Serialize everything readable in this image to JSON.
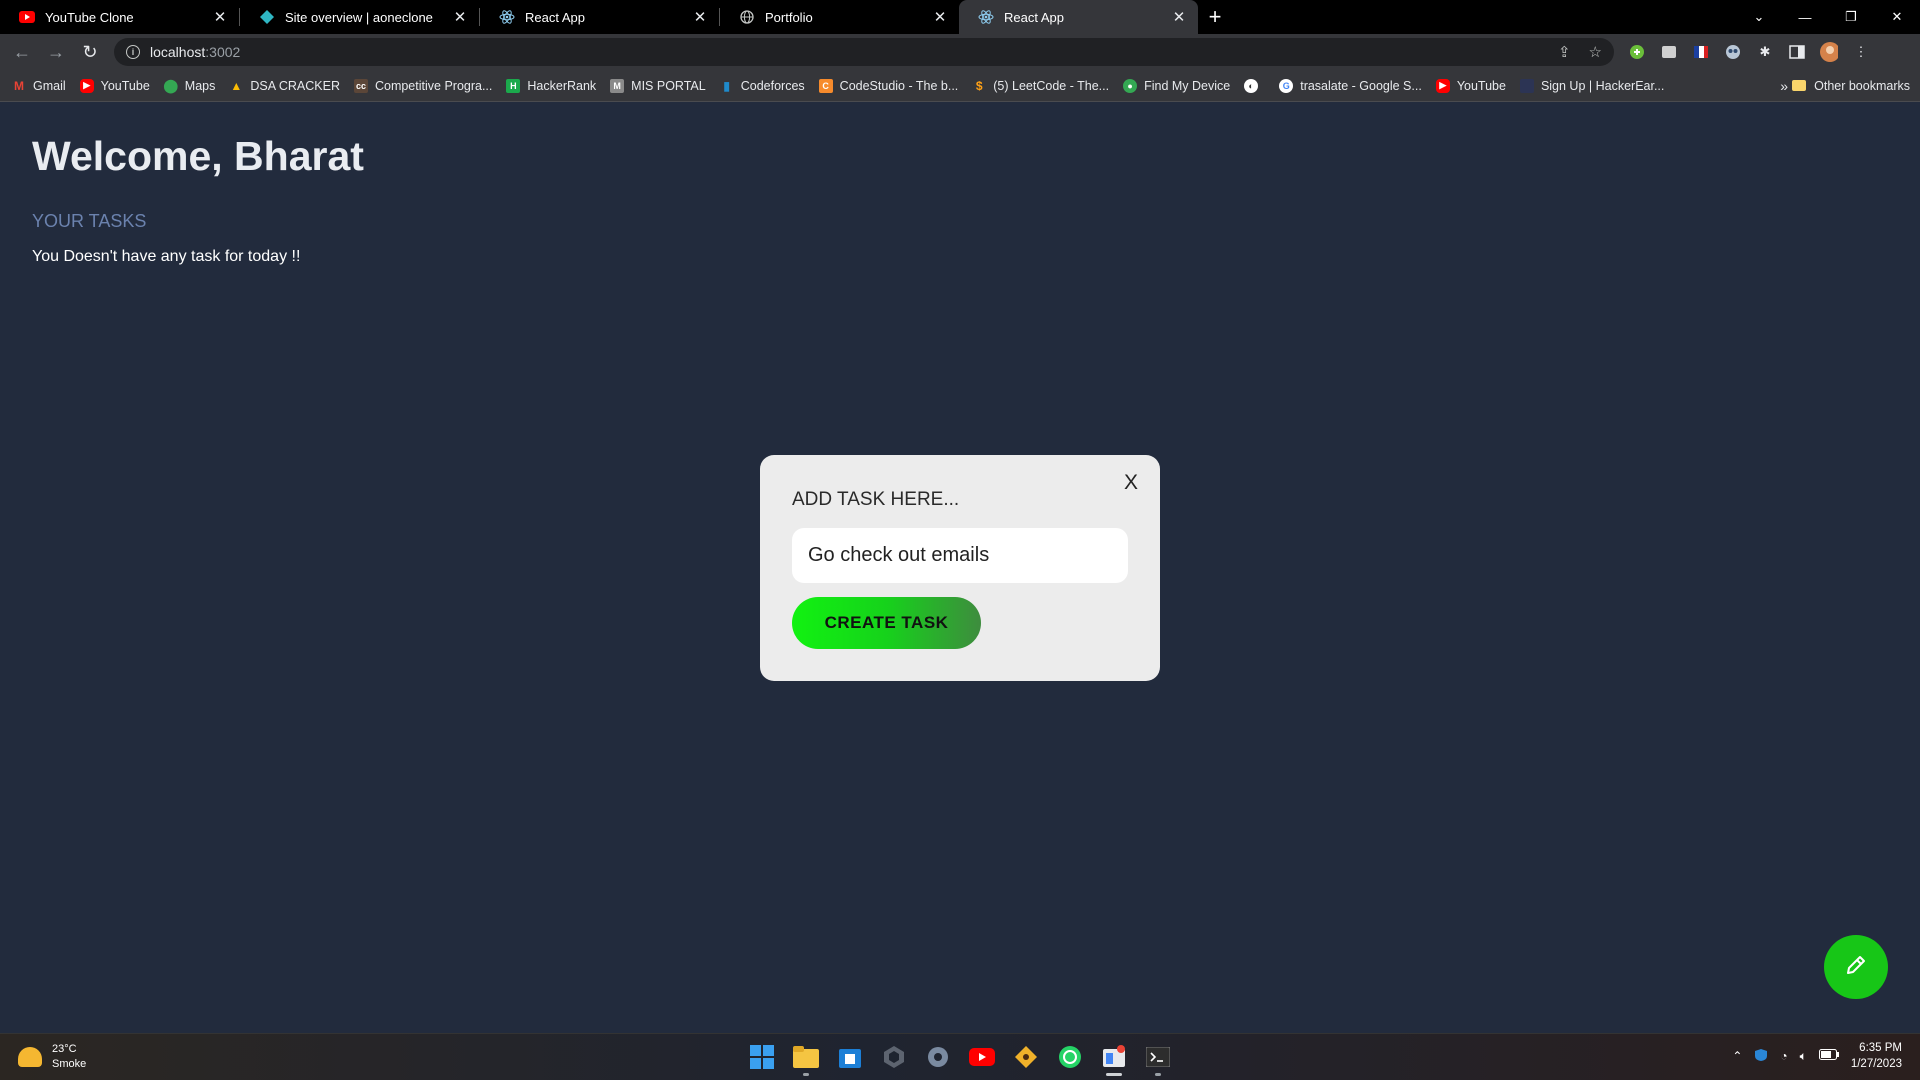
{
  "browser": {
    "tabs": [
      {
        "title": "YouTube Clone",
        "icon": "youtube-icon",
        "active": false
      },
      {
        "title": "Site overview | aoneclone",
        "icon": "netlify-icon",
        "active": false
      },
      {
        "title": "React App",
        "icon": "react-icon",
        "active": false
      },
      {
        "title": "Portfolio",
        "icon": "globe-icon",
        "active": false
      },
      {
        "title": "React App",
        "icon": "react-icon",
        "active": true
      }
    ],
    "url_host": "localhost",
    "url_port": ":3002",
    "bookmarks": [
      {
        "label": "Gmail",
        "icon": "gmail-icon",
        "color": "#ea4335"
      },
      {
        "label": "YouTube",
        "icon": "youtube-icon",
        "color": "#ff0000"
      },
      {
        "label": "Maps",
        "icon": "maps-icon",
        "color": "#34a853"
      },
      {
        "label": "DSA CRACKER",
        "icon": "drive-icon",
        "color": "#fbbc04"
      },
      {
        "label": "Competitive Progra...",
        "icon": "cc-icon",
        "color": "#5b4638"
      },
      {
        "label": "HackerRank",
        "icon": "hackerrank-icon",
        "color": "#1ba94c"
      },
      {
        "label": "MIS PORTAL",
        "icon": "mis-icon",
        "color": "#8a8a8a"
      },
      {
        "label": "Codeforces",
        "icon": "codeforces-icon",
        "color": "#1f8acb"
      },
      {
        "label": "CodeStudio - The b...",
        "icon": "codestudio-icon",
        "color": "#f78b2c"
      },
      {
        "label": "(5) LeetCode - The...",
        "icon": "leetcode-icon",
        "color": "#ffa116"
      },
      {
        "label": "Find My Device",
        "icon": "find-device-icon",
        "color": "#34a853"
      },
      {
        "label": "",
        "icon": "globe-icon",
        "color": "#ffffff"
      },
      {
        "label": "trasalate - Google S...",
        "icon": "google-icon",
        "color": "#4285f4"
      },
      {
        "label": "YouTube",
        "icon": "youtube-icon",
        "color": "#ff0000"
      },
      {
        "label": "Sign Up | HackerEar...",
        "icon": "hackerearth-icon",
        "color": "#2c3454"
      }
    ],
    "other_bookmarks": "Other bookmarks"
  },
  "page": {
    "welcome": "Welcome, Bharat",
    "tasks_heading": "YOUR TASKS",
    "empty_message": "You Doesn't have any task for today !!"
  },
  "modal": {
    "label": "ADD TASK HERE...",
    "close": "X",
    "input_value": "Go check out emails",
    "button": "CREATE TASK"
  },
  "taskbar": {
    "temperature": "23°C",
    "weather": "Smoke",
    "time": "6:35 PM",
    "date": "1/27/2023"
  },
  "colors": {
    "page_bg": "#222b3d",
    "accent_green": "#17c617",
    "heading_blue": "#6b82ae"
  }
}
